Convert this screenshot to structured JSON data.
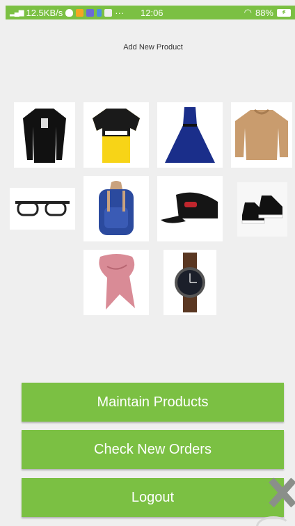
{
  "status_bar": {
    "network_speed": "12.5KB/s",
    "time": "12:06",
    "battery": "88%",
    "more": "···"
  },
  "screen": {
    "title": "Add New Product"
  },
  "products": [
    {
      "label": "black long sleeve t-shirt",
      "icon": "tshirt-icon"
    },
    {
      "label": "yellow football jersey",
      "icon": "jersey-icon"
    },
    {
      "label": "blue dress",
      "icon": "dress-icon"
    },
    {
      "label": "tan sweater",
      "icon": "sweater-icon"
    },
    {
      "label": "glasses",
      "icon": "glasses-icon"
    },
    {
      "label": "backpack",
      "icon": "backpack-icon"
    },
    {
      "label": "black cap",
      "icon": "cap-icon"
    },
    {
      "label": "sneakers",
      "icon": "shoes-icon"
    },
    {
      "label": "pink scarf",
      "icon": "scarf-icon"
    },
    {
      "label": "wrist watch",
      "icon": "watch-icon"
    }
  ],
  "buttons": {
    "maintain": "Maintain Products",
    "orders": "Check New Orders",
    "logout": "Logout"
  },
  "colors": {
    "accent": "#7bc043",
    "background": "#efefef"
  }
}
